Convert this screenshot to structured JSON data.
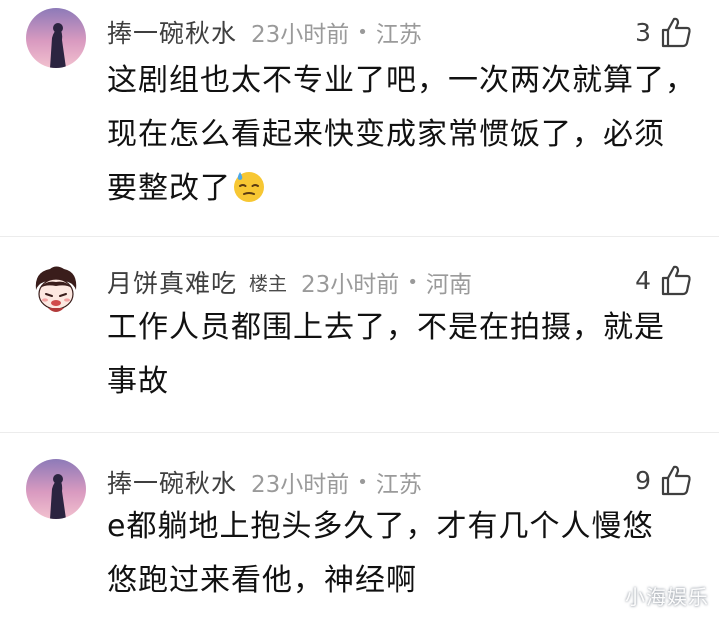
{
  "comments": [
    {
      "username": "捧一碗秋水",
      "op_badge": "",
      "time": "23小时前",
      "separator": "•",
      "location": "江苏",
      "likes": "3",
      "text_lines": [
        "这剧组也太不专业了吧，一次两次就算了，",
        "现在怎么看起来快变成家常惯饭了，必须",
        "要整改了"
      ],
      "emoji": "sweat-emoji"
    },
    {
      "username": "月饼真难吃",
      "op_badge": "楼主",
      "time": "23小时前",
      "separator": "•",
      "location": "河南",
      "likes": "4",
      "text_lines": [
        "工作人员都围上去了，不是在拍摄，就是",
        "事故"
      ],
      "emoji": ""
    },
    {
      "username": "捧一碗秋水",
      "op_badge": "",
      "time": "23小时前",
      "separator": "•",
      "location": "江苏",
      "likes": "9",
      "text_lines": [
        "e都躺地上抱头多久了，才有几个人慢悠",
        "悠跑过来看他，神经啊"
      ],
      "emoji": ""
    }
  ],
  "watermark": "小海娱乐",
  "colors": {
    "text": "#111111",
    "username": "#3f3f3f",
    "meta": "#9a9a9a",
    "divider": "#ececec"
  }
}
